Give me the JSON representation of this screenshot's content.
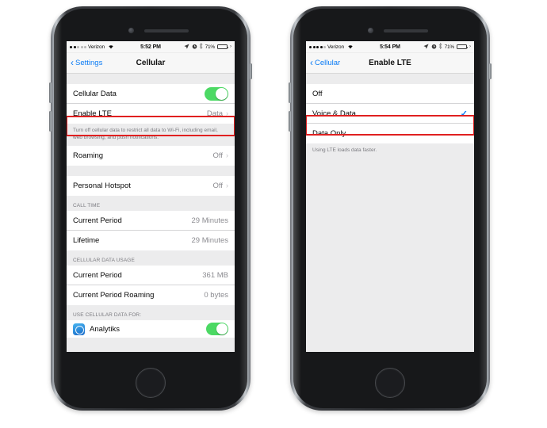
{
  "phones": {
    "left": {
      "statusbar": {
        "signal_dots_filled": 2,
        "signal_dots_total": 5,
        "carrier": "Verizon",
        "wifi_icon": "wifi-icon",
        "time": "5:52 PM",
        "location_icon": "location-arrow-icon",
        "alarm_icon": "alarm-clock-icon",
        "bluetooth_icon": "bluetooth-icon",
        "battery_percent": "71%",
        "battery_icon": "battery-icon"
      },
      "navbar": {
        "back_label": "Settings",
        "title": "Cellular",
        "back_icon": "chevron-left-icon"
      },
      "groups": [
        {
          "rows": [
            {
              "label": "Cellular Data",
              "control": "toggle",
              "toggle_on": true
            },
            {
              "label": "Enable LTE",
              "value": "Data",
              "control": "chevron",
              "highlighted": true
            }
          ],
          "footnote": "Turn off cellular data to restrict all data to Wi-Fi, including email, web browsing, and push notifications."
        },
        {
          "rows": [
            {
              "label": "Roaming",
              "value": "Off",
              "control": "chevron"
            }
          ]
        },
        {
          "rows": [
            {
              "label": "Personal Hotspot",
              "value": "Off",
              "control": "chevron"
            }
          ]
        },
        {
          "header": "CALL TIME",
          "rows": [
            {
              "label": "Current Period",
              "value": "29 Minutes"
            },
            {
              "label": "Lifetime",
              "value": "29 Minutes"
            }
          ]
        },
        {
          "header": "CELLULAR DATA USAGE",
          "rows": [
            {
              "label": "Current Period",
              "value": "361 MB"
            },
            {
              "label": "Current Period Roaming",
              "value": "0 bytes"
            }
          ]
        },
        {
          "header": "USE CELLULAR DATA FOR:",
          "rows": [
            {
              "label": "Analytiks",
              "control": "toggle",
              "toggle_on": true,
              "icon": "analytiks-app-icon"
            }
          ]
        }
      ]
    },
    "right": {
      "statusbar": {
        "signal_dots_filled": 4,
        "signal_dots_total": 5,
        "carrier": "Verizon",
        "wifi_icon": "wifi-icon",
        "time": "5:54 PM",
        "location_icon": "location-arrow-icon",
        "alarm_icon": "alarm-clock-icon",
        "bluetooth_icon": "bluetooth-icon",
        "battery_percent": "71%",
        "battery_icon": "battery-icon"
      },
      "navbar": {
        "back_label": "Cellular",
        "title": "Enable LTE",
        "back_icon": "chevron-left-icon"
      },
      "options": [
        {
          "label": "Off",
          "selected": false
        },
        {
          "label": "Voice & Data",
          "selected": true,
          "highlighted": true,
          "check_icon": "checkmark-icon"
        },
        {
          "label": "Data Only",
          "selected": false
        }
      ],
      "footnote": "Using LTE loads data faster."
    }
  },
  "colors": {
    "accent_blue": "#0a7bf5",
    "toggle_green": "#4cd964",
    "highlight_red": "#e02020",
    "content_gray": "#ececed"
  }
}
